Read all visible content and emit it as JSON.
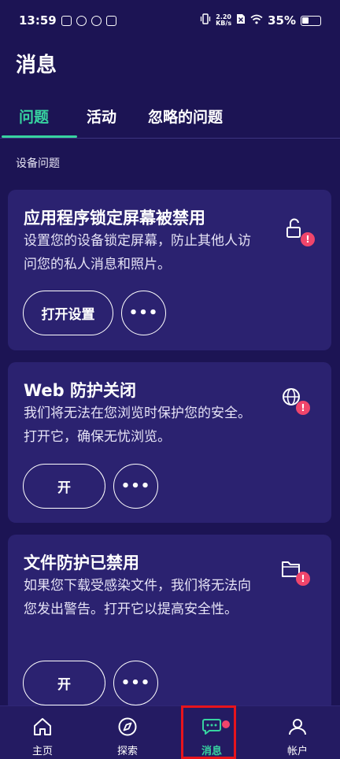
{
  "status_bar": {
    "time": "13:59",
    "net_speed_value": "2.20",
    "net_speed_unit": "KB/s",
    "battery_percent": "35%"
  },
  "header": {
    "title": "消息"
  },
  "tabs": [
    {
      "label": "问题",
      "active": true
    },
    {
      "label": "活动",
      "active": false
    },
    {
      "label": "忽略的问题",
      "active": false
    }
  ],
  "section": {
    "label": "设备问题"
  },
  "cards": [
    {
      "title": "应用程序锁定屏幕被禁用",
      "description": "设置您的设备锁定屏幕，防止其他人访问您的私人消息和照片。",
      "primary_button": "打开设置",
      "more_button": "•••",
      "icon": "lock-icon",
      "alert": "!"
    },
    {
      "title": "Web 防护关闭",
      "description": "我们将无法在您浏览时保护您的安全。打开它，确保无忧浏览。",
      "primary_button": "开",
      "more_button": "•••",
      "icon": "globe-icon",
      "alert": "!"
    },
    {
      "title": "文件防护已禁用",
      "description": "如果您下载受感染文件，我们将无法向您发出警告。打开它以提高安全性。",
      "primary_button": "开",
      "more_button": "•••",
      "icon": "folder-icon",
      "alert": "!"
    }
  ],
  "bottom_nav": [
    {
      "label": "主页",
      "icon": "home-icon",
      "active": false
    },
    {
      "label": "探索",
      "icon": "compass-icon",
      "active": false
    },
    {
      "label": "消息",
      "icon": "chat-icon",
      "active": true
    },
    {
      "label": "帐户",
      "icon": "user-icon",
      "active": false
    }
  ],
  "colors": {
    "background": "#1c1454",
    "card": "#2b2270",
    "accent": "#37d3a0",
    "alert": "#f0456b",
    "highlight_box": "#e8141c"
  }
}
